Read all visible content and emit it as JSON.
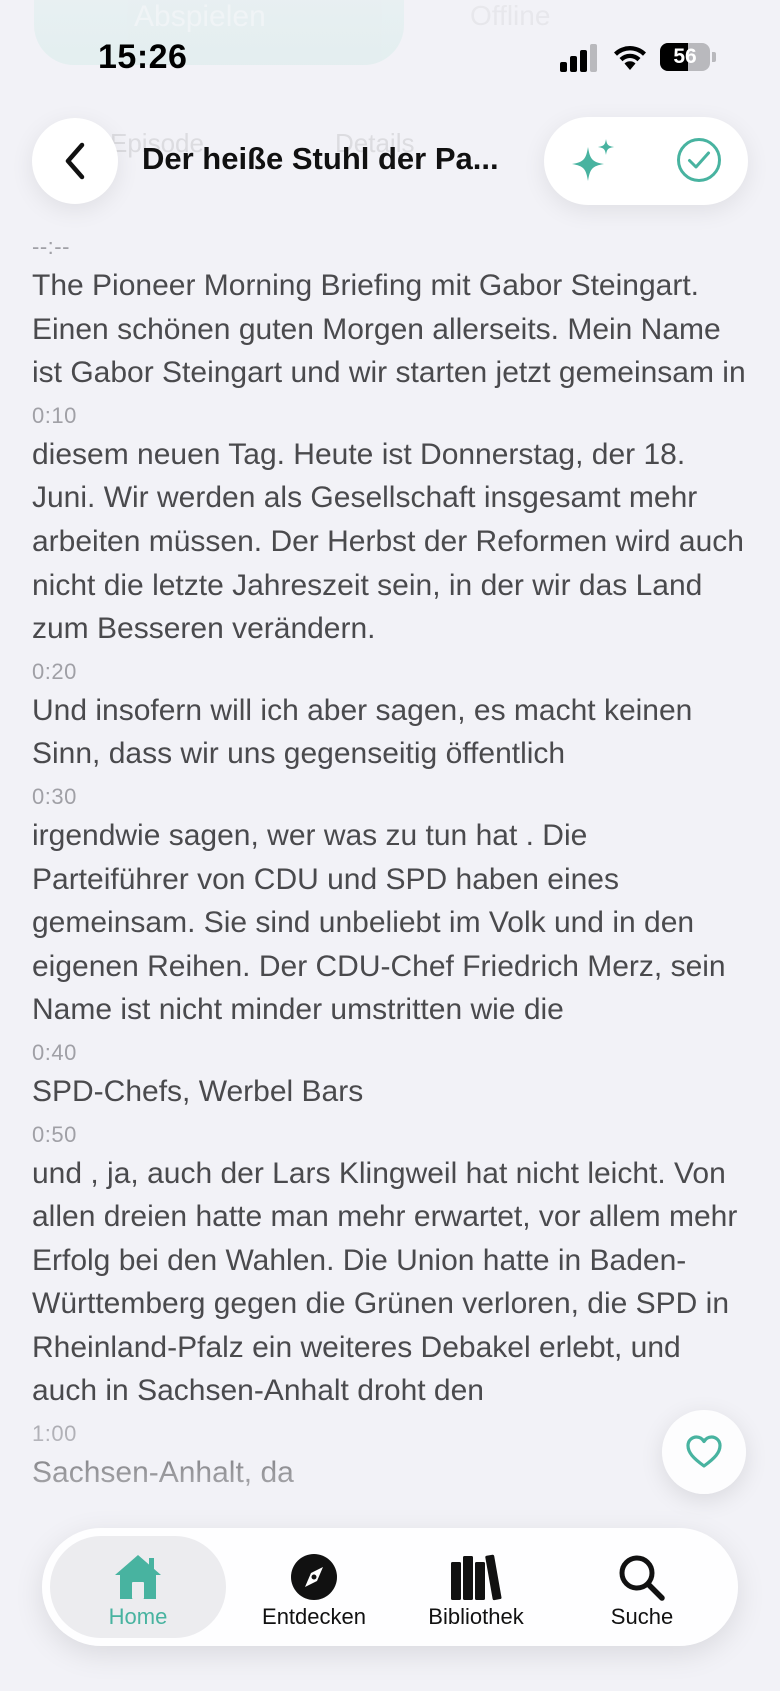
{
  "background_ghost": {
    "play_label": "Abspielen",
    "offline_label": "Offline",
    "tabs": [
      "Episode",
      "Details"
    ]
  },
  "status_bar": {
    "time": "15:26",
    "battery": "56"
  },
  "nav": {
    "title": "Der heiße Stuhl der Pa...",
    "accent_color": "#48b3a0"
  },
  "transcript": {
    "segments": [
      {
        "time": "--:--",
        "text": "The Pioneer Morning Briefing mit Gabor Steingart. Einen schönen guten Morgen allerseits. Mein Name ist Gabor Steingart und wir starten jetzt gemeinsam in"
      },
      {
        "time": "0:10",
        "text": "diesem neuen Tag. Heute ist Donnerstag, der 18. Juni. Wir werden als Gesellschaft insgesamt mehr arbeiten müssen. Der Herbst der Reformen wird auch nicht die letzte Jahreszeit sein, in der wir das Land zum Besseren verändern."
      },
      {
        "time": "0:20",
        "text": "Und insofern will ich aber sagen, es macht keinen Sinn, dass wir uns gegenseitig öffentlich"
      },
      {
        "time": "0:30",
        "text": "irgendwie sagen, wer was zu tun hat . Die Parteiführer von CDU und SPD haben eines gemeinsam. Sie sind unbeliebt im Volk und in den eigenen Reihen. Der CDU-Chef Friedrich Merz, sein Name ist nicht minder umstritten wie die"
      },
      {
        "time": "0:40",
        "text": "SPD-Chefs, Werbel Bars"
      },
      {
        "time": "0:50",
        "text": "und , ja, auch der Lars Klingweil hat nicht leicht. Von allen dreien hatte man mehr erwartet, vor allem mehr Erfolg bei den Wahlen. Die Union hatte in Baden-Württemberg gegen die Grünen verloren, die SPD in Rheinland-Pfalz ein weiteres Debakel erlebt, und auch in Sachsen-Anhalt droht den"
      },
      {
        "time": "1:00",
        "text": "Sachsen-Anhalt, da"
      }
    ]
  },
  "tab_bar": {
    "tabs": [
      {
        "label": "Home",
        "icon": "home-icon",
        "active": true
      },
      {
        "label": "Entdecken",
        "icon": "compass-icon",
        "active": false
      },
      {
        "label": "Bibliothek",
        "icon": "library-icon",
        "active": false
      },
      {
        "label": "Suche",
        "icon": "search-icon",
        "active": false
      }
    ]
  }
}
